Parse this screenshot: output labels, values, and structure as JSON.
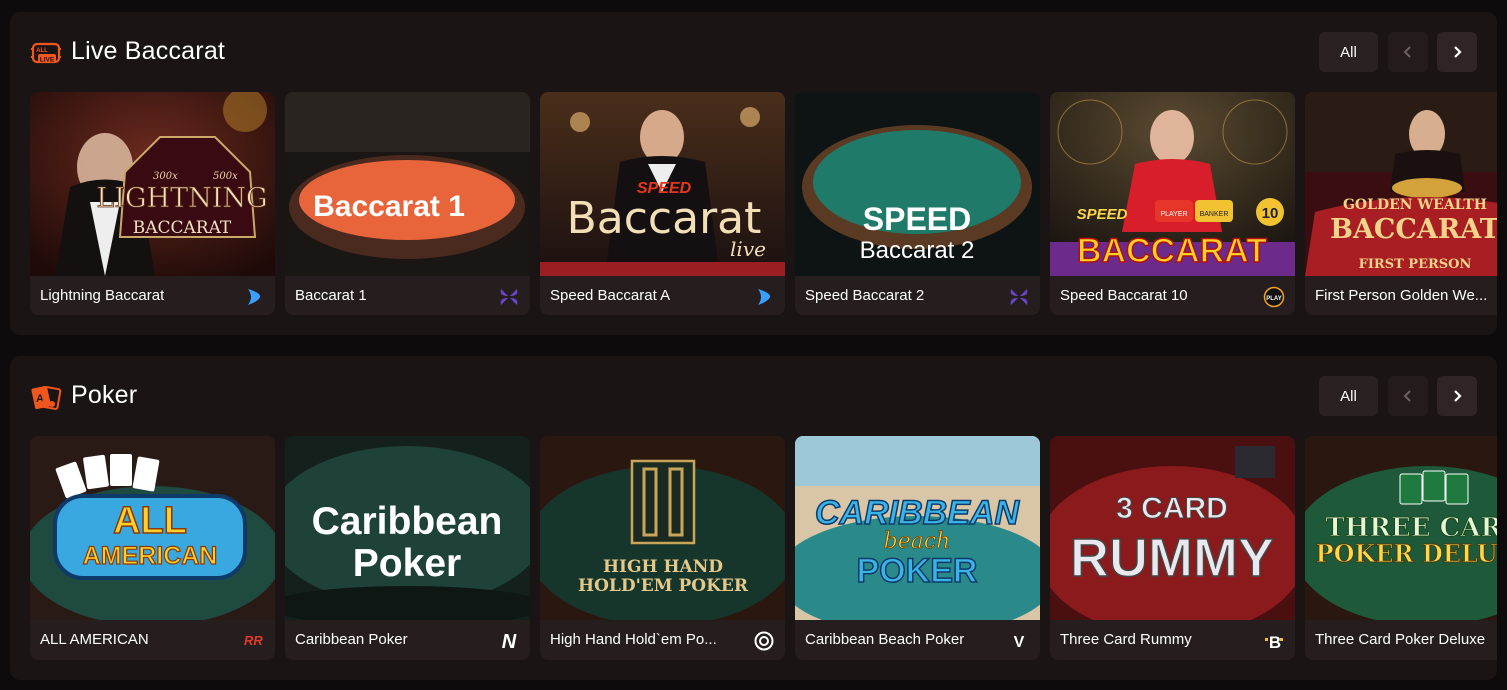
{
  "sections": [
    {
      "title": "Live Baccarat",
      "icon": "live-badge-icon",
      "all_label": "All",
      "cards": [
        {
          "name": "Lightning Baccarat",
          "provider_icon": "evolution-icon",
          "art": [
            "300x",
            "500x",
            "LIGHTNING",
            "BACCARAT"
          ]
        },
        {
          "name": "Baccarat 1",
          "provider_icon": "butterfly-provider-icon",
          "art": [
            "Baccarat 1"
          ]
        },
        {
          "name": "Speed Baccarat A",
          "provider_icon": "evolution-icon",
          "art": [
            "SPEED",
            "Baccarat",
            "live"
          ]
        },
        {
          "name": "Speed Baccarat 2",
          "provider_icon": "butterfly-provider-icon",
          "art": [
            "SPEED",
            "Baccarat 2"
          ]
        },
        {
          "name": "Speed Baccarat 10",
          "provider_icon": "play-provider-icon",
          "provider_text": "PLAY",
          "art": [
            "SPEED",
            "PLAYER",
            "BANKER",
            "10",
            "BACCARAT"
          ]
        },
        {
          "name": "First Person Golden We...",
          "provider_icon": "",
          "art": [
            "GOLDEN WEALTH",
            "BACCARAT",
            "FIRST PERSON"
          ]
        }
      ]
    },
    {
      "title": "Poker",
      "icon": "poker-cards-icon",
      "all_label": "All",
      "cards": [
        {
          "name": "ALL AMERICAN",
          "provider_icon": "rr-provider-icon",
          "provider_text": "RR",
          "art": [
            "ALL",
            "AMERICAN"
          ]
        },
        {
          "name": "Caribbean Poker",
          "provider_icon": "n-provider-icon",
          "provider_text": "N",
          "art": [
            "Caribbean",
            "Poker"
          ]
        },
        {
          "name": "High Hand Hold`em Po...",
          "provider_icon": "swirl-provider-icon",
          "art": [
            "HIGH HAND",
            "HOLD'EM POKER"
          ]
        },
        {
          "name": "Caribbean Beach Poker",
          "provider_icon": "v-provider-icon",
          "provider_text": "V",
          "art": [
            "CARIBBEAN",
            "beach",
            "POKER"
          ]
        },
        {
          "name": "Three Card Rummy",
          "provider_icon": "b-provider-icon",
          "provider_text": "B",
          "art": [
            "3 CARD",
            "RUMMY"
          ]
        },
        {
          "name": "Three Card Poker Deluxe",
          "provider_icon": "",
          "art": [
            "THREE CARD",
            "POKER DELUXE"
          ]
        }
      ]
    }
  ],
  "colors": {
    "page_bg": "#0f0a0b",
    "section_bg": "#1b1415",
    "accent_orange": "#f0571e"
  }
}
